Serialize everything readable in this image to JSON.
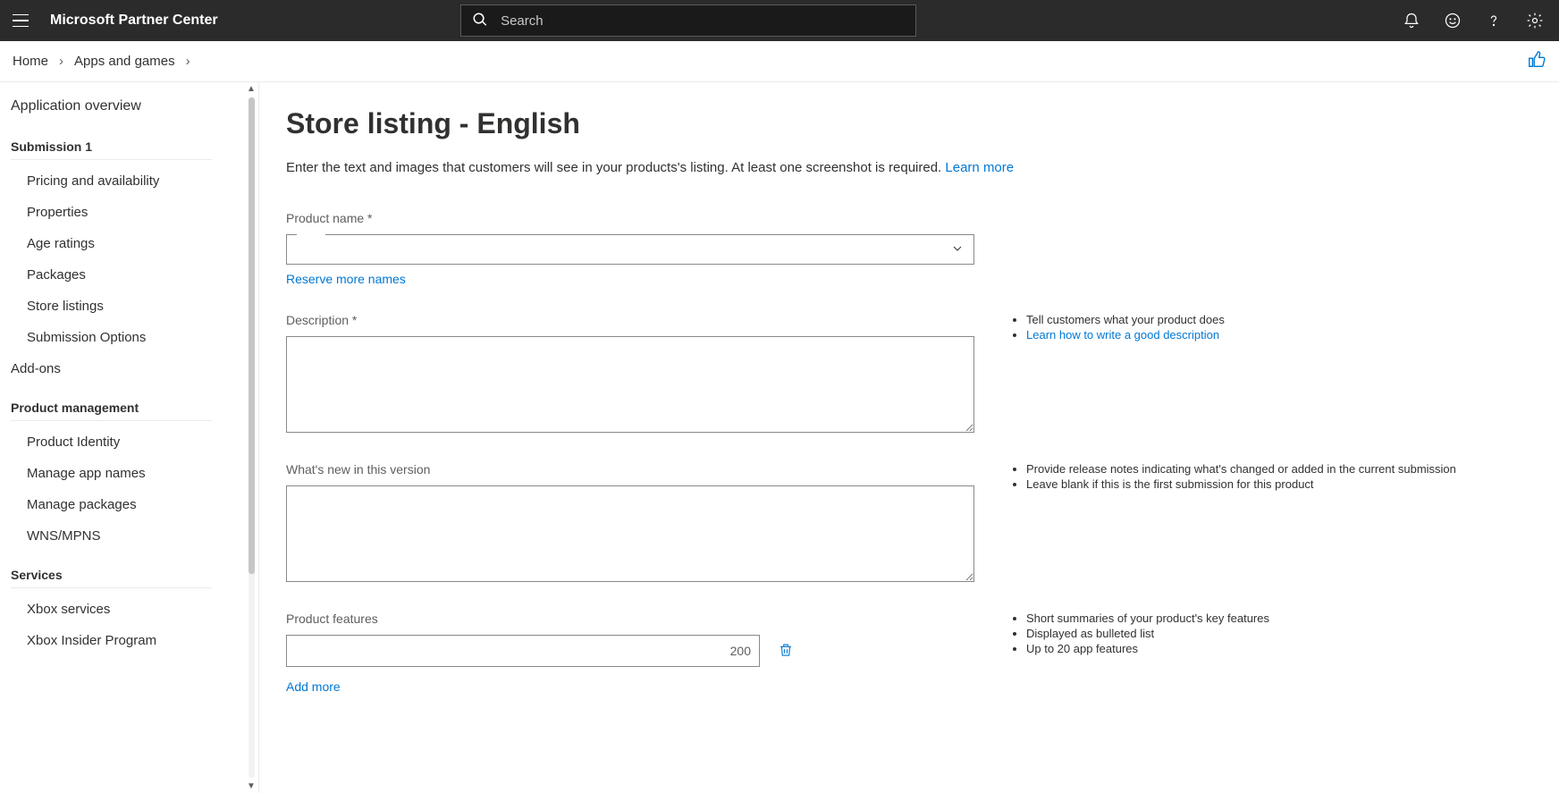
{
  "header": {
    "brand": "Microsoft Partner Center",
    "search_placeholder": "Search"
  },
  "breadcrumb": {
    "home": "Home",
    "apps": "Apps and games"
  },
  "sidebar": {
    "overview": "Application overview",
    "submission_label": "Submission 1",
    "submission_items": [
      "Pricing and availability",
      "Properties",
      "Age ratings",
      "Packages",
      "Store listings",
      "Submission Options"
    ],
    "addons": "Add-ons",
    "pm_label": "Product management",
    "pm_items": [
      "Product Identity",
      "Manage app names",
      "Manage packages",
      "WNS/MPNS"
    ],
    "services_label": "Services",
    "services_items": [
      "Xbox services",
      "Xbox Insider Program"
    ]
  },
  "main": {
    "title": "Store listing - English",
    "intro_text": "Enter the text and images that customers will see in your products's listing. At least one screenshot is required. ",
    "intro_link": "Learn more",
    "product_name_label": "Product name *",
    "reserve_link": "Reserve more names",
    "description_label": "Description *",
    "desc_tip1": "Tell customers what your product does",
    "desc_tip2_link": "Learn how to write a good description",
    "whats_new_label": "What's new in this version",
    "whats_new_tip1": "Provide release notes indicating what's changed or added in the current submission",
    "whats_new_tip2": "Leave blank if this is the first submission for this product",
    "features_label": "Product features",
    "features_count": "200",
    "features_tip1": "Short summaries of your product's key features",
    "features_tip2": "Displayed as bulleted list",
    "features_tip3": "Up to 20 app features",
    "add_more": "Add more"
  }
}
